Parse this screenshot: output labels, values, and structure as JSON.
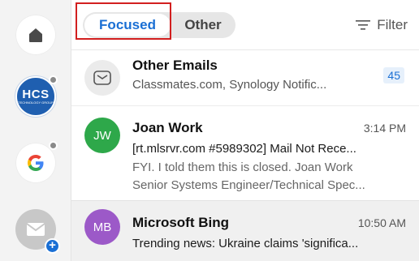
{
  "rail": {
    "accounts": [
      {
        "initials": "HCS",
        "subtitle": "TECHNOLOGY GROUP"
      }
    ]
  },
  "tabs": {
    "focused_label": "Focused",
    "other_label": "Other",
    "filter_label": "Filter"
  },
  "messages": [
    {
      "sender": "Other Emails",
      "preview": "Classmates.com, Synology Notific...",
      "count": "45"
    },
    {
      "initials": "JW",
      "sender": "Joan Work",
      "time": "3:14 PM",
      "subject": "[rt.mlsrvr.com #5989302] Mail Not Rece...",
      "preview1": "FYI. I told them this is closed. Joan Work",
      "preview2": "Senior Systems Engineer/Technical Spec..."
    },
    {
      "initials": "MB",
      "sender": "Microsoft Bing",
      "time": "10:50 AM",
      "subject": "Trending news: Ukraine claims 'significa..."
    }
  ],
  "colors": {
    "accent": "#1a6fd4",
    "highlight_box": "#d21f1f",
    "jw_avatar": "#2ea84a",
    "mb_avatar": "#9c59c8"
  }
}
